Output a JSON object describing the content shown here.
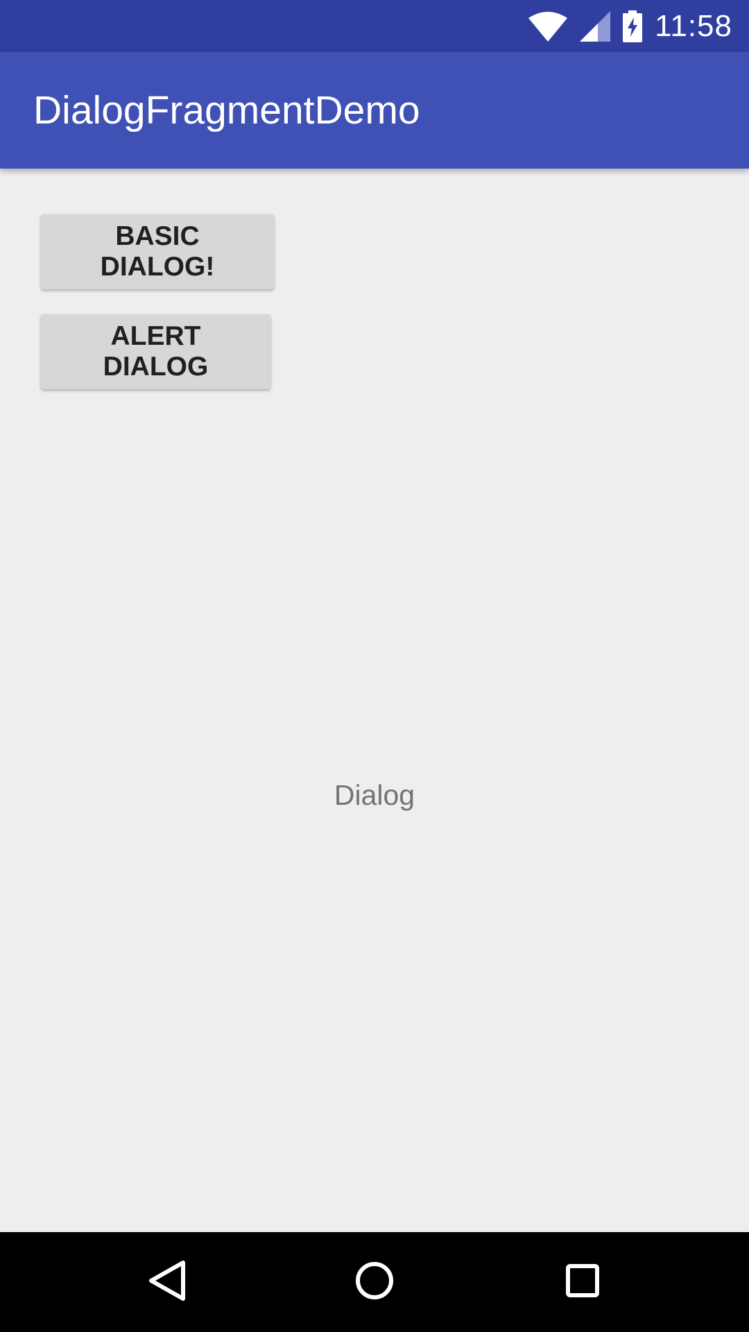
{
  "status_bar": {
    "time": "11:58",
    "icons": [
      "wifi-icon",
      "cell-signal-icon",
      "battery-charging-icon"
    ],
    "color": "#303f9f"
  },
  "app_bar": {
    "title": "DialogFragmentDemo",
    "color": "#3f51b5"
  },
  "main": {
    "buttons": [
      {
        "label": "BASIC DIALOG!"
      },
      {
        "label": "ALERT DIALOG"
      }
    ],
    "center_text": "Dialog",
    "background": "#eeeeee"
  },
  "nav_bar": {
    "icons": [
      "back-icon",
      "home-icon",
      "recents-icon"
    ]
  }
}
